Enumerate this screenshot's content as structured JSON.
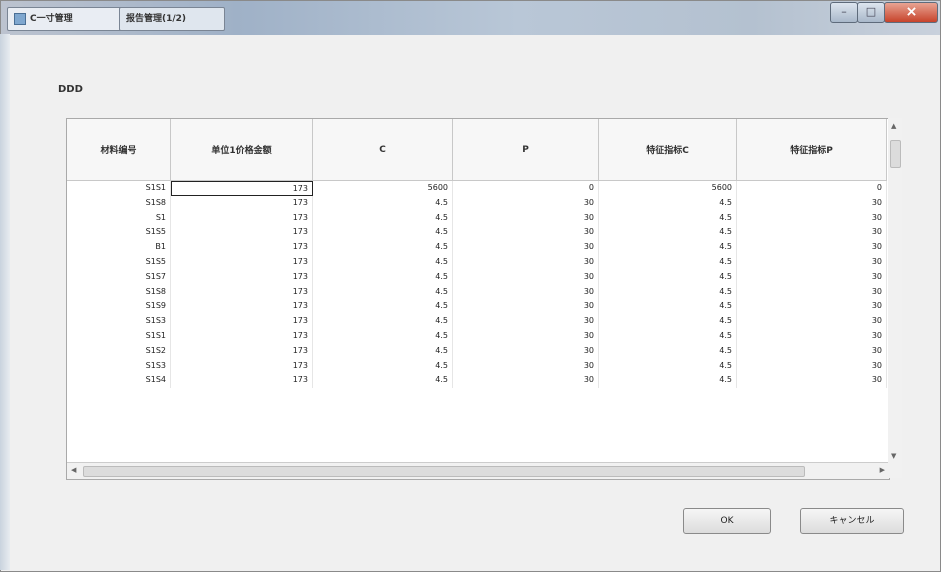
{
  "window": {
    "title_main": "C一寸管理",
    "title_sub": "报告管理(1/2)"
  },
  "section": {
    "label": "DDD"
  },
  "grid": {
    "columns": [
      "材料编号",
      "单位1价格金额",
      "C",
      "P",
      "特征指标C",
      "特征指标P"
    ],
    "rows": [
      [
        "S1S1",
        "173",
        "5600",
        "0",
        "5600",
        "0"
      ],
      [
        "S1S8",
        "173",
        "4.5",
        "30",
        "4.5",
        "30"
      ],
      [
        "S1",
        "173",
        "4.5",
        "30",
        "4.5",
        "30"
      ],
      [
        "S1S5",
        "173",
        "4.5",
        "30",
        "4.5",
        "30"
      ],
      [
        "B1",
        "173",
        "4.5",
        "30",
        "4.5",
        "30"
      ],
      [
        "S1S5",
        "173",
        "4.5",
        "30",
        "4.5",
        "30"
      ],
      [
        "S1S7",
        "173",
        "4.5",
        "30",
        "4.5",
        "30"
      ],
      [
        "S1S8",
        "173",
        "4.5",
        "30",
        "4.5",
        "30"
      ],
      [
        "S1S9",
        "173",
        "4.5",
        "30",
        "4.5",
        "30"
      ],
      [
        "S1S3",
        "173",
        "4.5",
        "30",
        "4.5",
        "30"
      ],
      [
        "S1S1",
        "173",
        "4.5",
        "30",
        "4.5",
        "30"
      ],
      [
        "S1S2",
        "173",
        "4.5",
        "30",
        "4.5",
        "30"
      ],
      [
        "S1S3",
        "173",
        "4.5",
        "30",
        "4.5",
        "30"
      ],
      [
        "S1S4",
        "173",
        "4.5",
        "30",
        "4.5",
        "30"
      ]
    ]
  },
  "buttons": {
    "ok": "OK",
    "cancel": "キャンセル"
  }
}
